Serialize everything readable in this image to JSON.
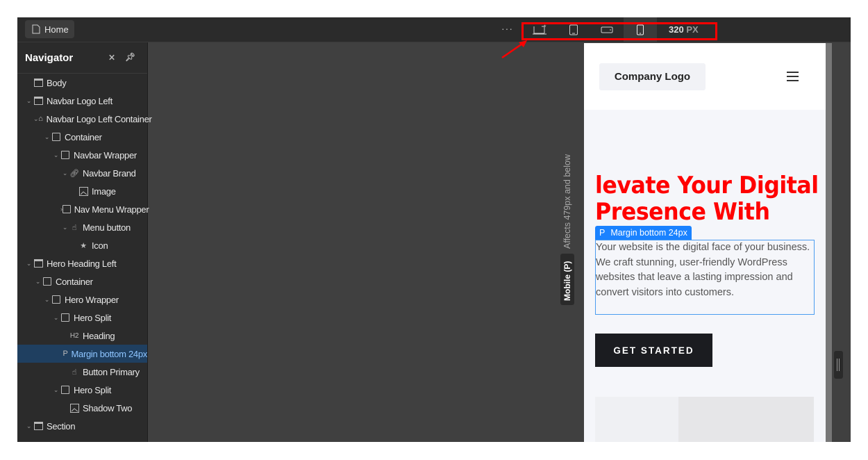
{
  "topbar": {
    "home_label": "Home",
    "more": "···",
    "breakpoints": [
      {
        "icon": "desktop-star-icon"
      },
      {
        "icon": "tablet-icon"
      },
      {
        "icon": "mobile-landscape-icon"
      },
      {
        "icon": "mobile-portrait-icon",
        "active": true
      }
    ],
    "width_value": "320",
    "width_unit": "PX"
  },
  "navigator": {
    "title": "Navigator",
    "items": [
      {
        "label": "Body",
        "icon": "section",
        "level": 0,
        "chev": ""
      },
      {
        "label": "Navbar Logo Left",
        "icon": "section",
        "level": 0,
        "chev": "v"
      },
      {
        "label": "Navbar Logo Left Container",
        "icon": "home",
        "level": 1,
        "chev": "v"
      },
      {
        "label": "Container",
        "icon": "box",
        "level": 2,
        "chev": "v"
      },
      {
        "label": "Navbar Wrapper",
        "icon": "box",
        "level": 3,
        "chev": "v"
      },
      {
        "label": "Navbar Brand",
        "icon": "link",
        "level": 4,
        "chev": "v"
      },
      {
        "label": "Image",
        "icon": "image",
        "level": 5,
        "chev": ""
      },
      {
        "label": "Nav Menu Wrapper",
        "icon": "box",
        "level": 4,
        "chev": ">"
      },
      {
        "label": "Menu button",
        "icon": "hand",
        "level": 4,
        "chev": "v"
      },
      {
        "label": "Icon",
        "icon": "star",
        "level": 5,
        "chev": ""
      },
      {
        "label": "Hero Heading Left",
        "icon": "section",
        "level": 0,
        "chev": "v"
      },
      {
        "label": "Container",
        "icon": "box",
        "level": 1,
        "chev": "v"
      },
      {
        "label": "Hero Wrapper",
        "icon": "box",
        "level": 2,
        "chev": "v"
      },
      {
        "label": "Hero Split",
        "icon": "box",
        "level": 3,
        "chev": "v"
      },
      {
        "label": "Heading",
        "icon": "h2",
        "level": 4,
        "chev": ""
      },
      {
        "label": "Margin bottom 24px",
        "icon": "p",
        "level": 4,
        "chev": "",
        "selected": true
      },
      {
        "label": "Button Primary",
        "icon": "hand",
        "level": 4,
        "chev": ""
      },
      {
        "label": "Hero Split",
        "icon": "box",
        "level": 3,
        "chev": "v"
      },
      {
        "label": "Shadow Two",
        "icon": "image",
        "level": 4,
        "chev": ""
      },
      {
        "label": "Section",
        "icon": "section",
        "level": 0,
        "chev": "v"
      }
    ]
  },
  "canvas": {
    "affects_label": "Affects 479px and below",
    "breakpoint_label": "Mobile (P)"
  },
  "preview": {
    "logo": "Company Logo",
    "heading": "levate Your Digital Presence With",
    "heading_line1": "levate Your Digital",
    "heading_line2": "Presence With",
    "selection_tag_type": "P",
    "selection_tag_label": "Margin bottom 24px",
    "paragraph": "Your website is the digital face of your business. We craft stunning, user-friendly WordPress websites that leave a lasting impression and convert visitors into customers.",
    "cta": "GET STARTED"
  },
  "colors": {
    "heading": "#ff0000",
    "selection": "#1a82ff",
    "highlight_box": "#ff0000"
  }
}
